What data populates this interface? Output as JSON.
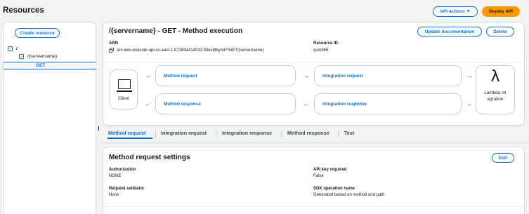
{
  "header": {
    "title": "Resources",
    "api_actions_label": "API actions ▼",
    "deploy_label": "Deploy API"
  },
  "sidebar": {
    "create_label": "Create resource",
    "tree": [
      {
        "label": "/"
      },
      {
        "label": "/{servername}"
      }
    ],
    "selected_method": "GET"
  },
  "method": {
    "title": "/{servername} - GET - Method execution",
    "update_doc_label": "Update documentation",
    "delete_label": "Delete",
    "arn_label": "ARN",
    "arn_value": "arn:aws:execute-api:us-east-1:872894414033:39exdlbyml/*/GET/{servername}",
    "resource_id_label": "Resource ID",
    "resource_id_value": "qsm985"
  },
  "flow": {
    "client_label": "Client",
    "method_request": "Method request",
    "integration_request": "Integration request",
    "method_response": "Method response",
    "integration_response": "Integration response",
    "lambda_label": "Lambda integration",
    "right_arrow": "→",
    "left_arrow": "←"
  },
  "tabs": [
    {
      "label": "Method request",
      "active": true
    },
    {
      "label": "Integration request"
    },
    {
      "label": "Integration response"
    },
    {
      "label": "Method response"
    },
    {
      "label": "Test"
    }
  ],
  "settings": {
    "title": "Method request settings",
    "edit_label": "Edit",
    "authorization_label": "Authorization",
    "authorization_value": "NONE",
    "api_key_label": "API key required",
    "api_key_value": "False",
    "validator_label": "Request validator",
    "validator_value": "None",
    "sdk_label": "SDK operation name",
    "sdk_value": "Generated based on method and path"
  },
  "colors": {
    "accent": "#0972d3",
    "deploy": "#ff9900",
    "background": "#f2f3f3",
    "card_border": "#d5dbdb"
  }
}
